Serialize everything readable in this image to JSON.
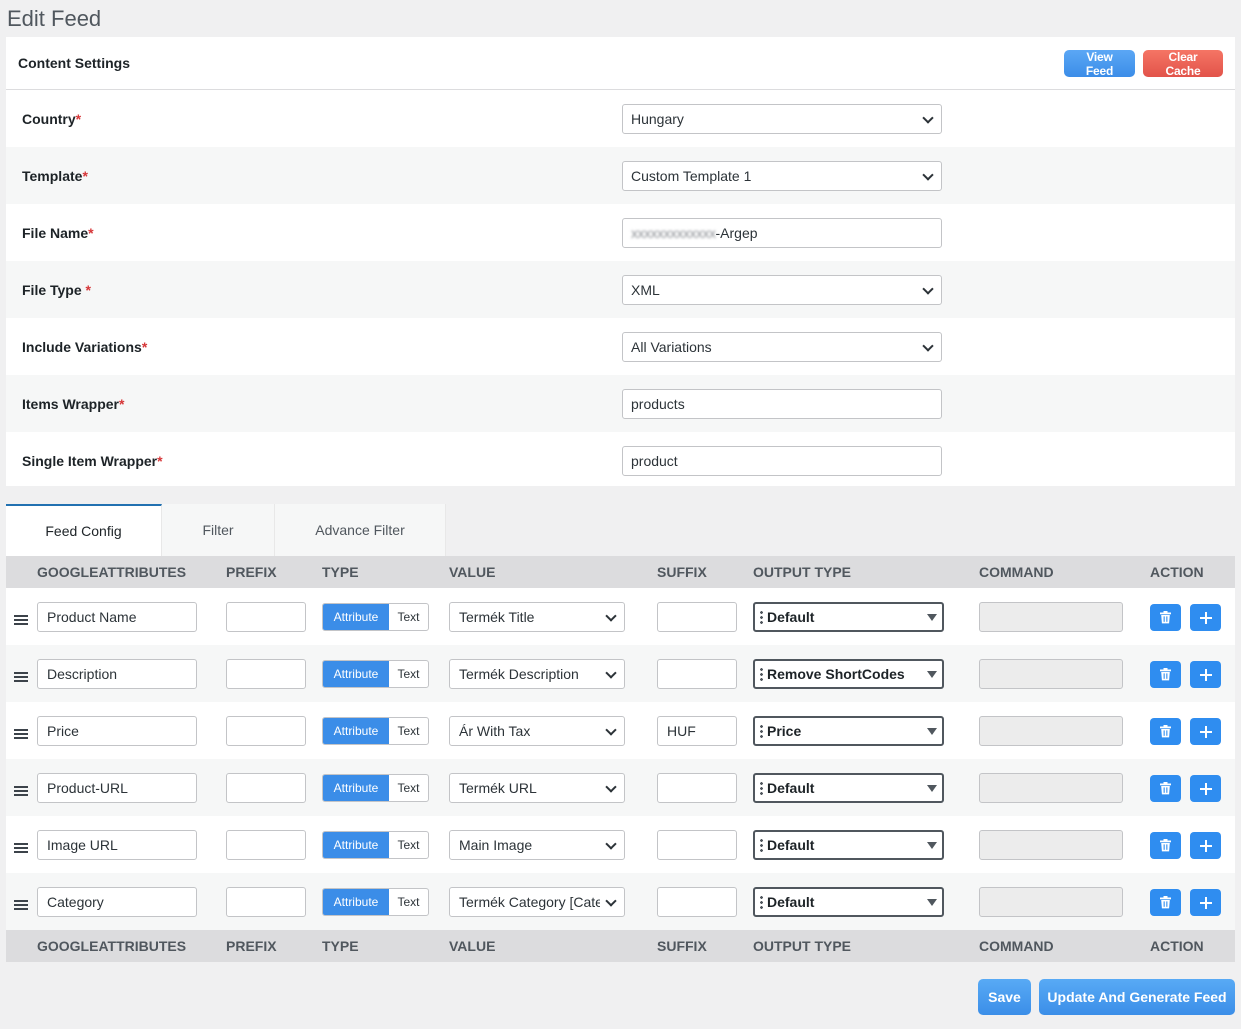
{
  "page_title": "Edit Feed",
  "content_settings": {
    "title": "Content Settings",
    "view_feed_label": "View Feed",
    "clear_cache_label": "Clear Cache",
    "fields": [
      {
        "label": "Country",
        "value": "Hungary"
      },
      {
        "label": "Template",
        "value": "Custom Template 1"
      },
      {
        "label": "File Name",
        "value_blurred": "xxxxxxxxxxxxx",
        "value": "-Argep"
      },
      {
        "label": "File Type ",
        "value": "XML"
      },
      {
        "label": "Include Variations",
        "value": "All Variations"
      },
      {
        "label": "Items Wrapper",
        "value": "products"
      },
      {
        "label": "Single Item Wrapper",
        "value": "product"
      }
    ],
    "required_mark": "*"
  },
  "tabs": [
    {
      "label": "Feed Config",
      "active": true
    },
    {
      "label": "Filter",
      "active": false
    },
    {
      "label": "Advance Filter",
      "active": false
    }
  ],
  "table": {
    "headers": {
      "google_attributes": "GOOGLEATTRIBUTES",
      "prefix": "PREFIX",
      "type": "TYPE",
      "value": "VALUE",
      "suffix": "SUFFIX",
      "output_type": "OUTPUT TYPE",
      "command": "COMMAND",
      "action": "ACTION"
    },
    "type_labels": {
      "attribute": "Attribute",
      "text": "Text"
    },
    "rows": [
      {
        "attribute": "Product Name",
        "prefix": "",
        "value": "Termék Title",
        "suffix": "",
        "output_type": "Default",
        "command": ""
      },
      {
        "attribute": "Description",
        "prefix": "",
        "value": "Termék Description",
        "suffix": "",
        "output_type": "Remove ShortCodes",
        "command": ""
      },
      {
        "attribute": "Price",
        "prefix": "",
        "value": "Ár With Tax",
        "suffix": "HUF",
        "output_type": "Price",
        "command": ""
      },
      {
        "attribute": "Product-URL",
        "prefix": "",
        "value": "Termék URL",
        "suffix": "",
        "output_type": "Default",
        "command": ""
      },
      {
        "attribute": "Image URL",
        "prefix": "",
        "value": "Main Image",
        "suffix": "",
        "output_type": "Default",
        "command": ""
      },
      {
        "attribute": "Category",
        "prefix": "",
        "value": "Termék Category [Category",
        "suffix": "",
        "output_type": "Default",
        "command": ""
      }
    ]
  },
  "footer": {
    "save_label": "Save",
    "update_label": "Update And Generate Feed"
  },
  "colors": {
    "primary": "#3b8de8",
    "danger": "#e2534a",
    "required": "#d63638"
  }
}
